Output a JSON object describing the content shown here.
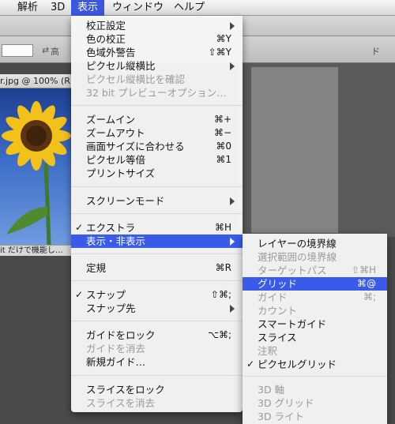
{
  "menubar": {
    "items": [
      "解析",
      "3D",
      "表示",
      "ウィンドウ",
      "ヘルプ"
    ],
    "active_index": 2
  },
  "optionsbar": {
    "swap_icon": "swap-icon",
    "label_partial": "高",
    "right_label": "ド"
  },
  "document": {
    "tab_title": "r.jpg @ 100% (R",
    "status_text": "it だけで機能し…"
  },
  "view_menu": {
    "groups": [
      [
        {
          "label": "校正設定",
          "shortcut": "",
          "submenu": true,
          "enabled": true
        },
        {
          "label": "色の校正",
          "shortcut": "⌘Y",
          "submenu": false,
          "enabled": true
        },
        {
          "label": "色域外警告",
          "shortcut": "⇧⌘Y",
          "submenu": false,
          "enabled": true
        },
        {
          "label": "ピクセル縦横比",
          "shortcut": "",
          "submenu": true,
          "enabled": true
        },
        {
          "label": "ピクセル縦横比を確認",
          "shortcut": "",
          "submenu": false,
          "enabled": false
        },
        {
          "label": "32 bit プレビューオプション…",
          "shortcut": "",
          "submenu": false,
          "enabled": false
        }
      ],
      [
        {
          "label": "ズームイン",
          "shortcut": "⌘+",
          "submenu": false,
          "enabled": true
        },
        {
          "label": "ズームアウト",
          "shortcut": "⌘−",
          "submenu": false,
          "enabled": true
        },
        {
          "label": "画面サイズに合わせる",
          "shortcut": "⌘0",
          "submenu": false,
          "enabled": true
        },
        {
          "label": "ピクセル等倍",
          "shortcut": "⌘1",
          "submenu": false,
          "enabled": true
        },
        {
          "label": "プリントサイズ",
          "shortcut": "",
          "submenu": false,
          "enabled": true
        }
      ],
      [
        {
          "label": "スクリーンモード",
          "shortcut": "",
          "submenu": true,
          "enabled": true
        }
      ],
      [
        {
          "label": "エクストラ",
          "shortcut": "⌘H",
          "submenu": false,
          "enabled": true,
          "checked": true
        },
        {
          "label": "表示・非表示",
          "shortcut": "",
          "submenu": true,
          "enabled": true,
          "highlighted": true
        }
      ],
      [
        {
          "label": "定規",
          "shortcut": "⌘R",
          "submenu": false,
          "enabled": true
        }
      ],
      [
        {
          "label": "スナップ",
          "shortcut": "⇧⌘;",
          "submenu": false,
          "enabled": true,
          "checked": true
        },
        {
          "label": "スナップ先",
          "shortcut": "",
          "submenu": true,
          "enabled": true
        }
      ],
      [
        {
          "label": "ガイドをロック",
          "shortcut": "⌥⌘;",
          "submenu": false,
          "enabled": true
        },
        {
          "label": "ガイドを消去",
          "shortcut": "",
          "submenu": false,
          "enabled": false
        },
        {
          "label": "新規ガイド…",
          "shortcut": "",
          "submenu": false,
          "enabled": true
        }
      ],
      [
        {
          "label": "スライスをロック",
          "shortcut": "",
          "submenu": false,
          "enabled": true
        },
        {
          "label": "スライスを消去",
          "shortcut": "",
          "submenu": false,
          "enabled": false
        }
      ]
    ]
  },
  "show_submenu": {
    "groups": [
      [
        {
          "label": "レイヤーの境界線",
          "shortcut": "",
          "enabled": true
        },
        {
          "label": "選択範囲の境界線",
          "shortcut": "",
          "enabled": false
        },
        {
          "label": "ターゲットパス",
          "shortcut": "⇧⌘H",
          "enabled": false
        },
        {
          "label": "グリッド",
          "shortcut": "⌘@",
          "enabled": true,
          "highlighted": true
        },
        {
          "label": "ガイド",
          "shortcut": "⌘;",
          "enabled": false
        },
        {
          "label": "カウント",
          "shortcut": "",
          "enabled": false
        },
        {
          "label": "スマートガイド",
          "shortcut": "",
          "enabled": true
        },
        {
          "label": "スライス",
          "shortcut": "",
          "enabled": true
        },
        {
          "label": "注釈",
          "shortcut": "",
          "enabled": false
        },
        {
          "label": "ピクセルグリッド",
          "shortcut": "",
          "enabled": true,
          "checked": true
        }
      ],
      [
        {
          "label": "3D 軸",
          "shortcut": "",
          "enabled": false
        },
        {
          "label": "3D グリッド",
          "shortcut": "",
          "enabled": false
        },
        {
          "label": "3D ライト",
          "shortcut": "",
          "enabled": false
        }
      ]
    ]
  },
  "colors": {
    "highlight": "#3a5bea",
    "menubar_active": "#3b57e0",
    "disabled_text": "#9a9a9a"
  }
}
